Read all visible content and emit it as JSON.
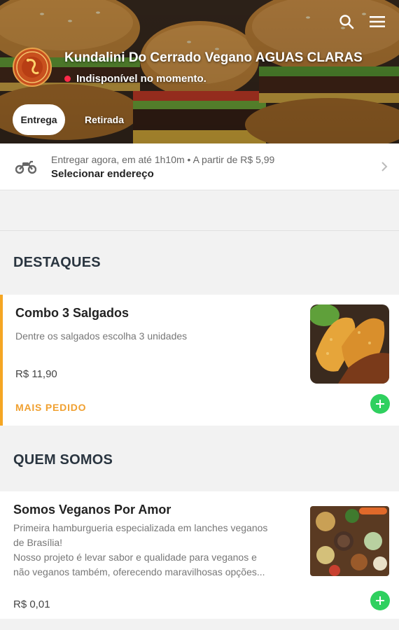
{
  "header": {
    "store_name": "Kundalini Do Cerrado Vegano AGUAS CLARAS",
    "status": "Indisponível no momento.",
    "icons": [
      "search-icon",
      "menu-icon"
    ]
  },
  "modes": [
    {
      "label": "Entrega",
      "active": true
    },
    {
      "label": "Retirada",
      "active": false
    }
  ],
  "delivery": {
    "info": "Entregar agora, em até 1h10m • A partir de R$ 5,99",
    "address_action": "Selecionar endereço"
  },
  "sections": [
    {
      "title": "DESTAQUES",
      "items": [
        {
          "name": "Combo 3 Salgados",
          "description": "Dentre os salgados escolha 3 unidades",
          "price": "R$ 11,90",
          "badge": "MAIS PEDIDO"
        }
      ]
    },
    {
      "title": "QUEM SOMOS",
      "items": [
        {
          "name": "Somos Veganos Por Amor",
          "description_lines": [
            "Primeira hamburgueria especializada em lanches veganos",
            "de Brasília!",
            "Nosso projeto é levar sabor e qualidade para veganos e",
            "não veganos também, oferecendo maravilhosas opções..."
          ],
          "price": "R$ 0,01"
        }
      ]
    }
  ],
  "colors": {
    "accent": "#f5a623",
    "add_button": "#2fd05f",
    "status_dot": "#ff2a4a"
  }
}
